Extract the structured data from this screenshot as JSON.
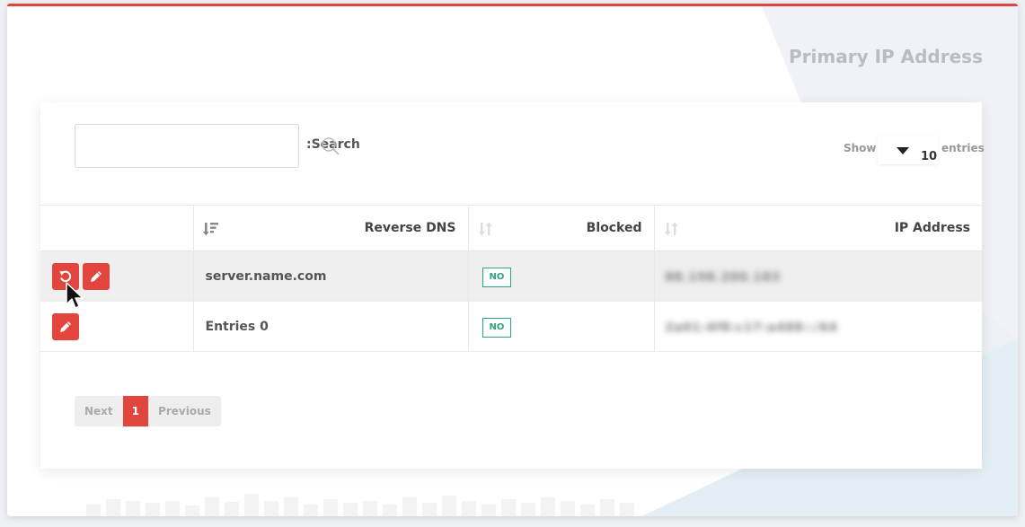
{
  "page": {
    "title": "Primary IP Address"
  },
  "toolbar": {
    "search_label": ":Search",
    "search_value": "",
    "show_label": "Show",
    "entries_value": "10",
    "entries_label": "entries"
  },
  "table": {
    "headers": {
      "dns": "Reverse DNS",
      "blocked": "Blocked",
      "ip": "IP Address"
    },
    "rows": [
      {
        "dns": "server.name.com",
        "blocked": "NO",
        "ip": "88.198.200.183",
        "actions": [
          "reset",
          "edit"
        ]
      },
      {
        "dns": "Entries 0",
        "blocked": "NO",
        "ip": "2a01:4f8:c17:a488::/64",
        "actions": [
          "edit"
        ]
      }
    ]
  },
  "pagination": {
    "next": "Next",
    "current": "1",
    "previous": "Previous"
  },
  "colors": {
    "accent": "#e2453d",
    "badge": "#2aa77b"
  },
  "icons": [
    "search-icon",
    "sort-icon",
    "reset-icon",
    "pencil-icon",
    "caret-down-icon",
    "mouse-cursor-icon"
  ]
}
